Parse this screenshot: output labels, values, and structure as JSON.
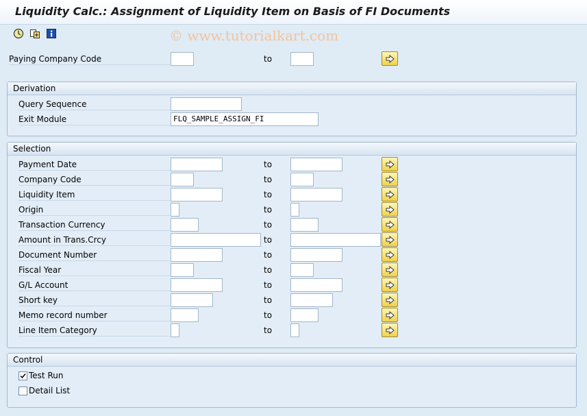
{
  "title": "Liquidity Calc.: Assignment of Liquidity Item on Basis of FI Documents",
  "watermark": "© www.tutorialkart.com",
  "toolbar": {
    "icons": [
      "execute-icon",
      "get-variant-icon",
      "info-icon"
    ]
  },
  "to_label": "to",
  "paying_company_code": {
    "label": "Paying Company Code",
    "from": "",
    "to": ""
  },
  "derivation": {
    "title": "Derivation",
    "query_sequence": {
      "label": "Query Sequence",
      "value": ""
    },
    "exit_module": {
      "label": "Exit Module",
      "value": "FLQ_SAMPLE_ASSIGN_FI"
    }
  },
  "selection": {
    "title": "Selection",
    "rows": [
      {
        "label": "Payment Date",
        "from": "",
        "to": ""
      },
      {
        "label": "Company Code",
        "from": "",
        "to": ""
      },
      {
        "label": "Liquidity Item",
        "from": "",
        "to": ""
      },
      {
        "label": "Origin",
        "from": "",
        "to": ""
      },
      {
        "label": "Transaction Currency",
        "from": "",
        "to": ""
      },
      {
        "label": "Amount in Trans.Crcy",
        "from": "",
        "to": ""
      },
      {
        "label": "Document Number",
        "from": "",
        "to": ""
      },
      {
        "label": "Fiscal Year",
        "from": "",
        "to": ""
      },
      {
        "label": "G/L Account",
        "from": "",
        "to": ""
      },
      {
        "label": "Short key",
        "from": "",
        "to": ""
      },
      {
        "label": "Memo record number",
        "from": "",
        "to": ""
      },
      {
        "label": "Line Item Category",
        "from": "",
        "to": ""
      }
    ]
  },
  "control": {
    "title": "Control",
    "test_run": {
      "label": "Test Run",
      "checked": true
    },
    "detail_list": {
      "label": "Detail List",
      "checked": false
    }
  },
  "colors": {
    "background": "#dfebf5",
    "arrow_button": "#f0d24a",
    "group_border": "#9fb9d4"
  }
}
